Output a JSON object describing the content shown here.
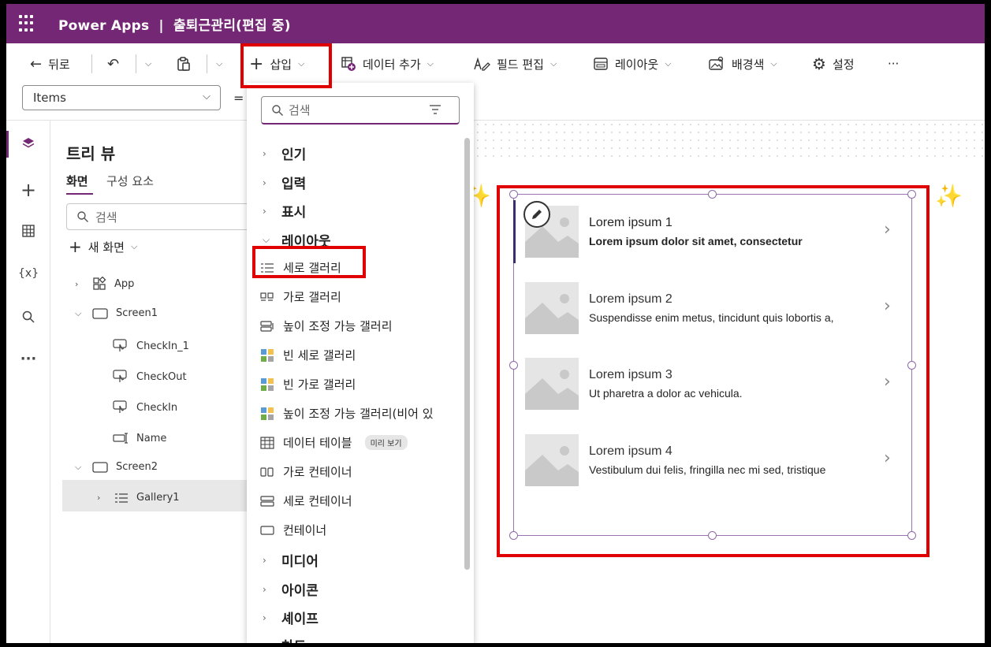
{
  "titlebar": {
    "app_name": "Power Apps",
    "separator": "|",
    "document": "출퇴근관리(편집 중)"
  },
  "commands": {
    "back": "뒤로",
    "insert": "삽입",
    "add_data": "데이터 추가",
    "edit_fields": "필드 편집",
    "layout": "레이아웃",
    "background": "배경색",
    "settings": "설정",
    "more": "···"
  },
  "formula": {
    "property": "Items",
    "equals": "="
  },
  "tree": {
    "title": "트리 뷰",
    "tab_screens": "화면",
    "tab_components": "구성 요소",
    "search_placeholder": "검색",
    "new_screen": "새 화면",
    "nodes": [
      "App",
      "Screen1",
      "CheckIn_1",
      "CheckOut",
      "CheckIn",
      "Name",
      "Screen2",
      "Gallery1"
    ]
  },
  "insert_menu": {
    "search_placeholder": "검색",
    "categories": [
      "인기",
      "입력",
      "표시",
      "레이아웃",
      "미디어",
      "아이콘",
      "셰이프",
      "차트"
    ],
    "layout_options": [
      "세로 갤러리",
      "가로 갤러리",
      "높이 조정 가능 갤러리",
      "빈 세로 갤러리",
      "빈 가로 갤러리",
      "높이 조정 가능 갤러리(비어 있",
      "데이터 테이블",
      "가로 컨테이너",
      "세로 컨테이너",
      "컨테이너"
    ],
    "preview_badge": "미리 보기"
  },
  "gallery": {
    "items": [
      {
        "title": "Lorem ipsum 1",
        "subtitle": "Lorem ipsum dolor sit amet, consectetur"
      },
      {
        "title": "Lorem ipsum 2",
        "subtitle": "Suspendisse enim metus, tincidunt quis lobortis a,"
      },
      {
        "title": "Lorem ipsum 3",
        "subtitle": "Ut pharetra a dolor ac vehicula."
      },
      {
        "title": "Lorem ipsum 4",
        "subtitle": "Vestibulum dui felis, fringilla nec mi sed, tristique"
      }
    ]
  },
  "colors": {
    "brand": "#742774",
    "highlight": "#e00000",
    "selection": "#9b72b0"
  }
}
